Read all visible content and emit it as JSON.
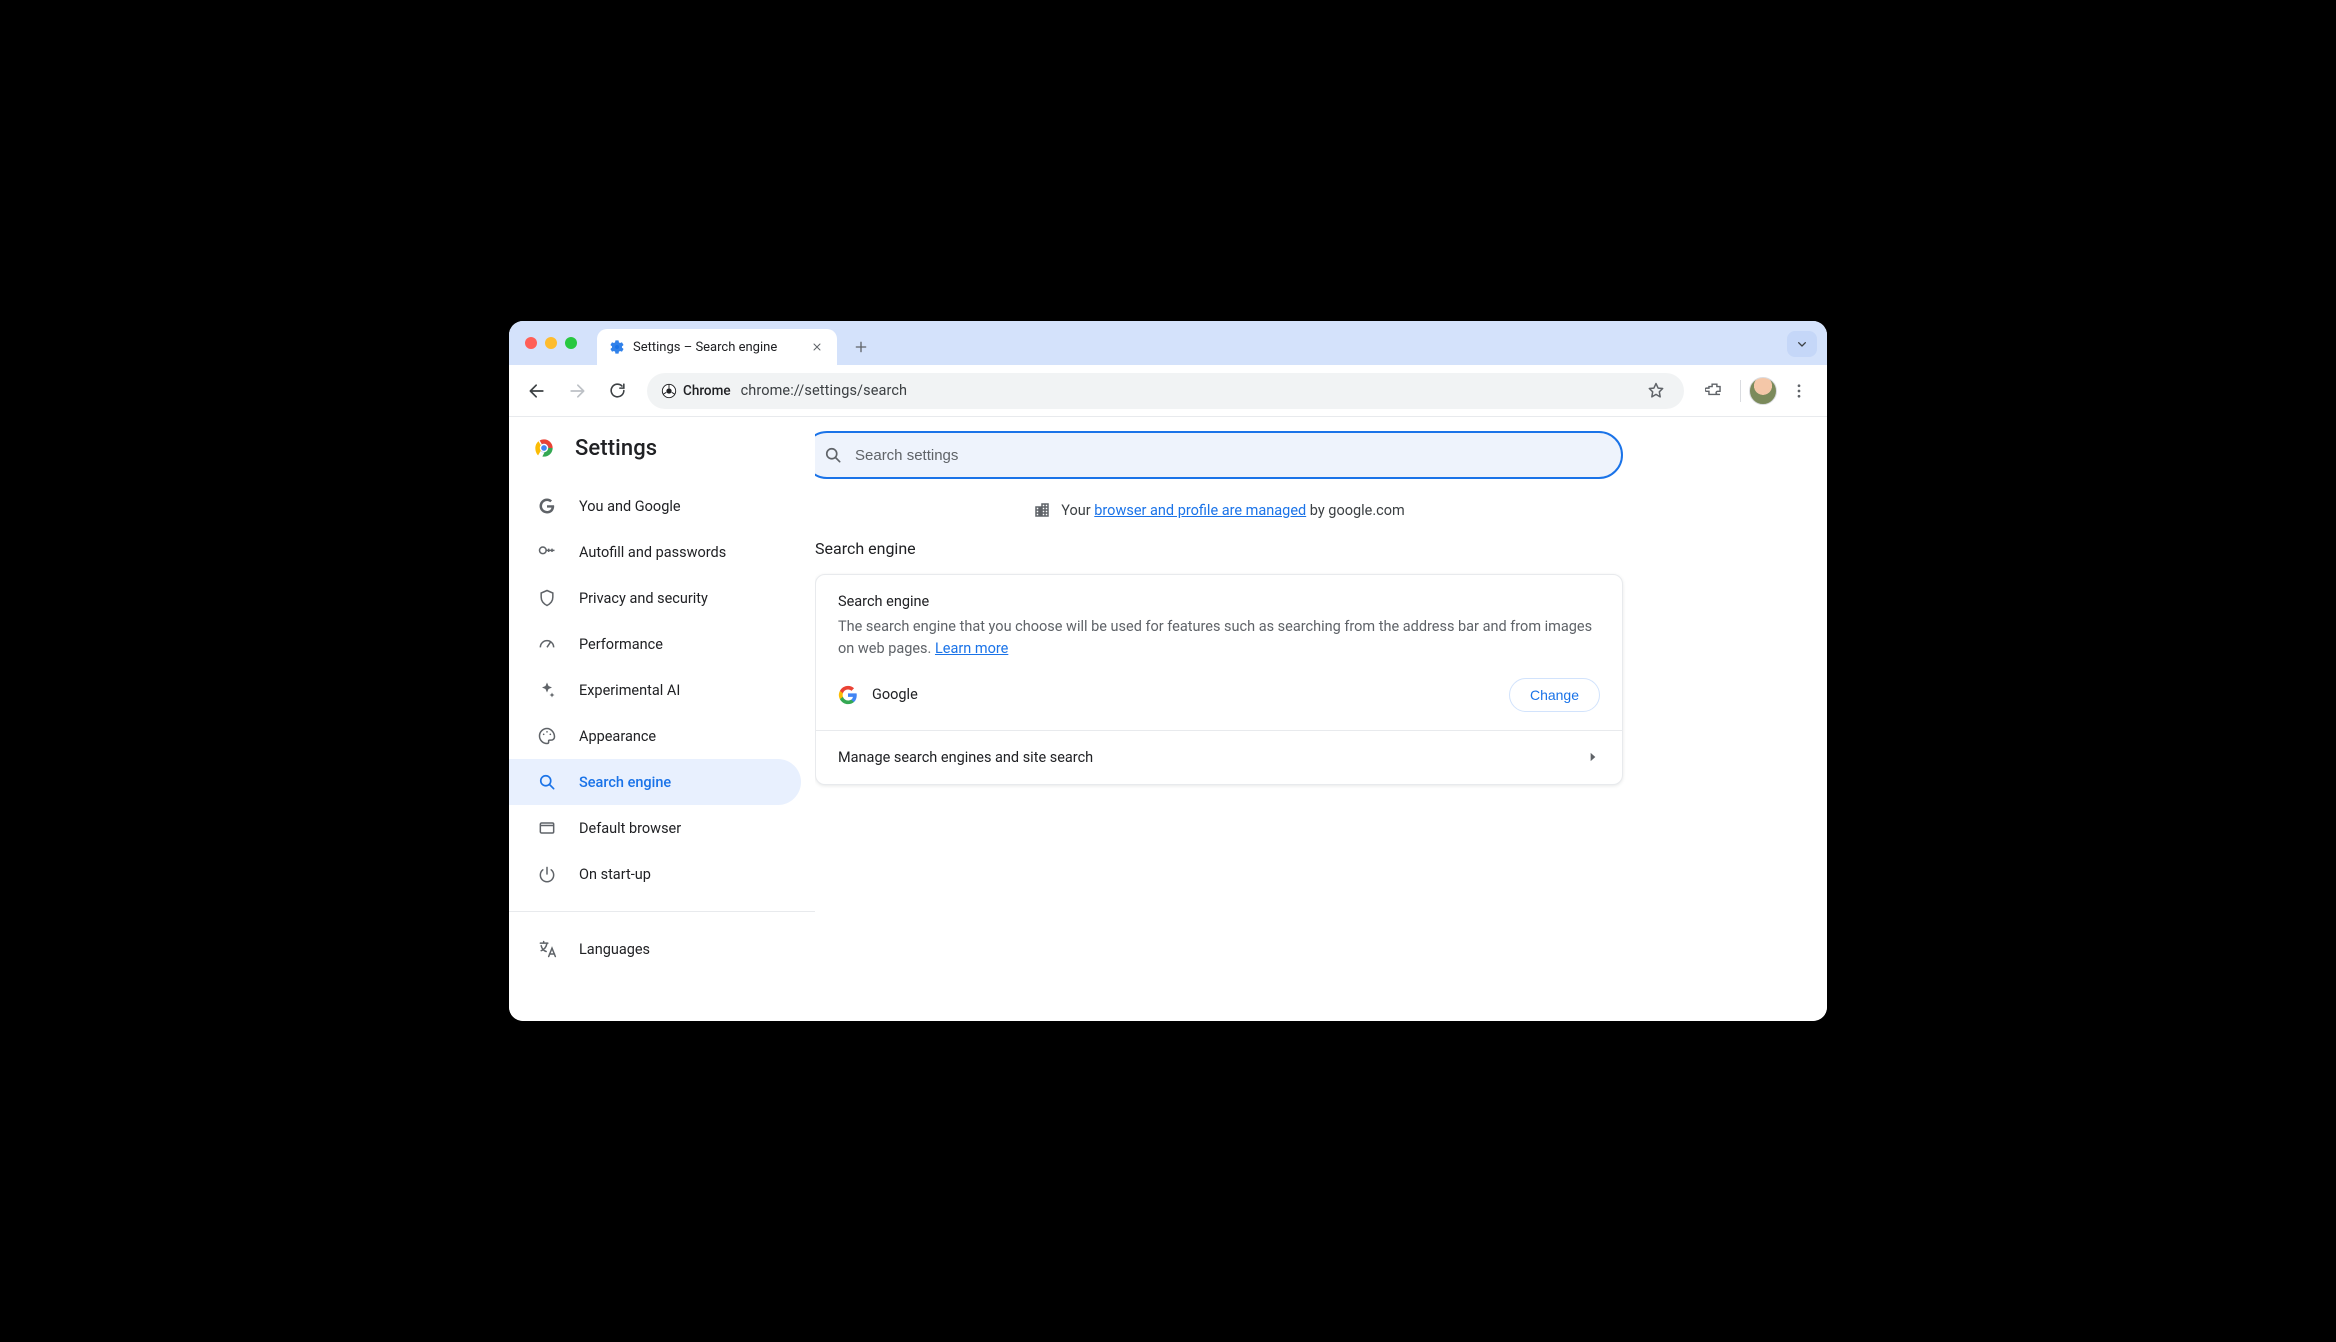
{
  "tab": {
    "title": "Settings – Search engine"
  },
  "omnibox": {
    "chip_label": "Chrome",
    "url_scheme": "chrome://",
    "url_host": "settings/",
    "url_path": "search"
  },
  "sidebar": {
    "title": "Settings",
    "items": [
      {
        "label": "You and Google"
      },
      {
        "label": "Autofill and passwords"
      },
      {
        "label": "Privacy and security"
      },
      {
        "label": "Performance"
      },
      {
        "label": "Experimental AI"
      },
      {
        "label": "Appearance"
      },
      {
        "label": "Search engine"
      },
      {
        "label": "Default browser"
      },
      {
        "label": "On start-up"
      }
    ],
    "items_after_divider": [
      {
        "label": "Languages"
      }
    ]
  },
  "search": {
    "placeholder": "Search settings"
  },
  "managed": {
    "prefix": "Your ",
    "link": "browser and profile are managed",
    "suffix": " by google.com"
  },
  "main": {
    "section_title": "Search engine",
    "card_heading": "Search engine",
    "card_desc_1": "The search engine that you choose will be used for features such as searching from the address bar and from images on web pages. ",
    "learn_more": "Learn more",
    "current_engine": "Google",
    "change_label": "Change",
    "manage_label": "Manage search engines and site search"
  }
}
